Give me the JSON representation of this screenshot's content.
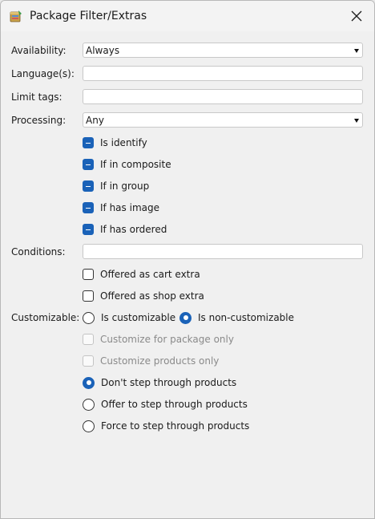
{
  "window": {
    "title": "Package Filter/Extras"
  },
  "form": {
    "availability": {
      "label": "Availability:",
      "value": "Always"
    },
    "languages": {
      "label": "Language(s):",
      "value": ""
    },
    "limit_tags": {
      "label": "Limit tags:",
      "value": ""
    },
    "processing": {
      "label": "Processing:",
      "value": "Any"
    },
    "processing_checks": [
      {
        "label": "Is identify",
        "state": "indeterminate"
      },
      {
        "label": "If in composite",
        "state": "indeterminate"
      },
      {
        "label": "If in group",
        "state": "indeterminate"
      },
      {
        "label": "If has image",
        "state": "indeterminate"
      },
      {
        "label": "If has ordered",
        "state": "indeterminate"
      }
    ],
    "conditions": {
      "label": "Conditions:",
      "value": ""
    },
    "extras": [
      {
        "label": "Offered as cart extra",
        "checked": false
      },
      {
        "label": "Offered as shop extra",
        "checked": false
      }
    ],
    "customizable": {
      "label": "Customizable:",
      "options": [
        {
          "label": "Is customizable",
          "selected": false
        },
        {
          "label": "Is non-customizable",
          "selected": true
        }
      ]
    },
    "customize_checks": [
      {
        "label": "Customize for package only",
        "enabled": false,
        "checked": false
      },
      {
        "label": "Customize products only",
        "enabled": false,
        "checked": false
      }
    ],
    "step_through": [
      {
        "label": "Don't step through products",
        "selected": true
      },
      {
        "label": "Offer to step through products",
        "selected": false
      },
      {
        "label": "Force to step through products",
        "selected": false
      }
    ]
  },
  "colors": {
    "accent": "#1a62b8",
    "background": "#f0f0f0"
  }
}
